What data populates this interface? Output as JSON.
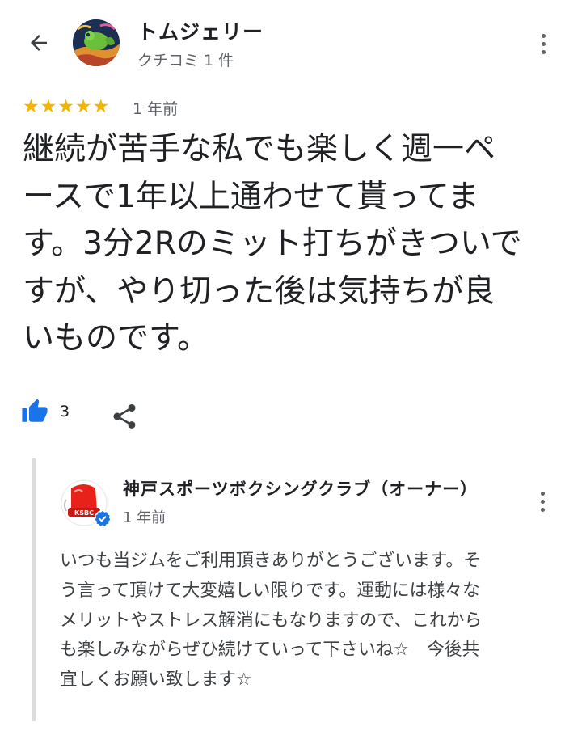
{
  "header": {
    "back_icon": "arrow-left-icon",
    "user_name": "トムジェリー",
    "user_sub": "クチコミ 1 件",
    "more_icon": "more-vert-icon"
  },
  "review": {
    "rating": 5,
    "rating_max": 5,
    "star_char": "★",
    "time": "1 年前",
    "text": "継続が苦手な私でも楽しく週一ペ\nースで1年以上通わせて貰ってま\nす。3分2Rのミット打ちがきついで\nすが、やり切った後は気持ちが良\nいものです。",
    "like_count": "3",
    "like_icon": "thumbs-up-icon",
    "share_icon": "share-icon"
  },
  "reply": {
    "owner_name": "神戸スポーツボクシングクラブ（オーナー）",
    "time": "1 年前",
    "avatar_text": "KSBC",
    "verified_icon": "verified-badge-icon",
    "text": "いつも当ジムをご利用頂きありがとうございます。そ\nう言って頂けて大変嬉しい限りです。運動には様々な\nメリットやストレス解消にもなりますので、これから\nも楽しみながらぜひ続けていって下さいね☆　今後共\n宜しくお願い致します☆"
  },
  "colors": {
    "star": "#f4b400",
    "like": "#1a73e8",
    "text_primary": "#202124",
    "text_secondary": "#5f6368",
    "owner_avatar_red": "#e8221a",
    "verified": "#1a73e8"
  }
}
